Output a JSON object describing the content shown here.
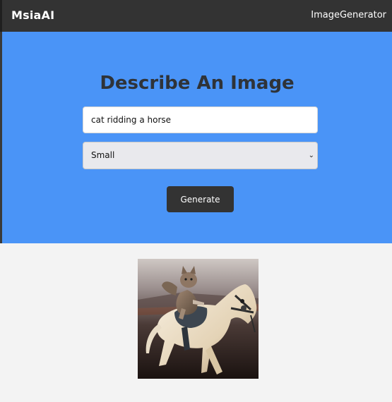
{
  "navbar": {
    "brand": "MsiaAI",
    "link_label": "ImageGenerator"
  },
  "form": {
    "title": "Describe An Image",
    "prompt_value": "cat ridding a horse",
    "size_selected": "Small",
    "generate_label": "Generate"
  },
  "colors": {
    "navbar_bg": "#333333",
    "hero_bg": "#4a94f7",
    "page_bg": "#f3f3f3",
    "button_bg": "#333333"
  },
  "icons": {
    "select_chevron": "chevron-down-icon"
  }
}
